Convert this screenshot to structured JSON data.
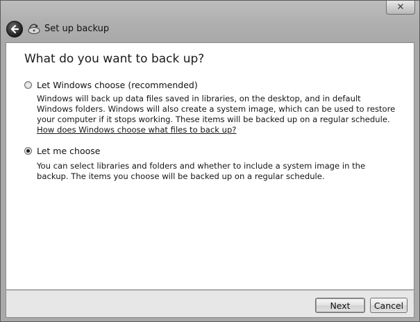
{
  "window": {
    "title": "Set up backup",
    "close_symbol": "✕"
  },
  "main": {
    "heading": "What do you want to back up?",
    "options": [
      {
        "label": "Let Windows choose (recommended)",
        "selected": false,
        "description": "Windows will back up data files saved in libraries, on the desktop, and in default Windows folders. Windows will also create a system image, which can be used to restore your computer if it stops working. These items will be backed up on a regular schedule.",
        "link": "How does Windows choose what files to back up?"
      },
      {
        "label": "Let me choose",
        "selected": true,
        "description": "You can select libraries and folders and whether to include a system image in the backup. The items you choose will be backed up on a regular schedule."
      }
    ]
  },
  "footer": {
    "next_label": "Next",
    "cancel_label": "Cancel"
  },
  "icons": {
    "back": "back-arrow-icon",
    "app": "backup-icon",
    "close": "close-icon"
  }
}
